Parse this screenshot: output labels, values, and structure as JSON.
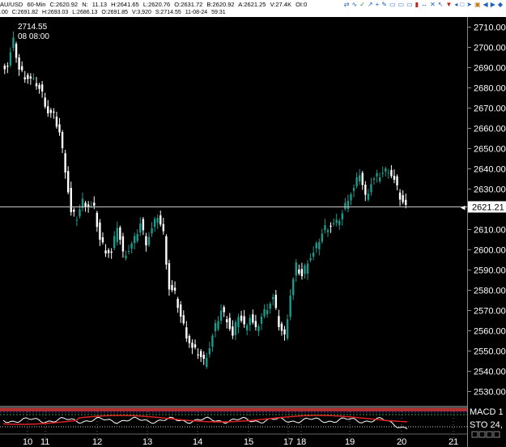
{
  "header": {
    "fields": [
      "AU/USD",
      "60-Min",
      "C:2620.92",
      "N:",
      "11.13",
      "H:2641.65",
      "L:2620.76",
      "O:2631.72",
      "B:2620.92",
      "A:2621.25",
      "V:27.4K",
      "OI:0"
    ]
  },
  "info_bar": {
    "fields": [
      ".00",
      "C:2691.82",
      "H:2693.03",
      "L:2686.13",
      "O:2691.85",
      "V:3,920",
      "S:2714.55",
      "11-08-24",
      "59:31"
    ]
  },
  "toolbar": {
    "icons": [
      "arrows-icon",
      "wave-icon",
      "check-icon",
      "trend-icon",
      "plus-icon",
      "pencil-icon",
      "box-icon",
      "box-icon-2",
      "box-icon-3",
      "bottle-icon",
      "arrows-icon-2",
      "cross-icon",
      "cursor-icon",
      "down-arrow-icon",
      "left-arrow-icon",
      "square-icon",
      "pointer-icon",
      "lock-icon",
      "prev-icon",
      "next-icon",
      "adjust-icon"
    ]
  },
  "hover": {
    "price": "2714.55",
    "time": "08 08:00"
  },
  "price_label": "2621.21",
  "indicators": {
    "macd": "MACD 1",
    "sto": "STO 24,"
  },
  "colors": {
    "up": "#1a9a8a",
    "down": "#ffffff",
    "background": "#000000",
    "sto": "#ffffff",
    "signal": "#dd2222"
  },
  "chart_data": {
    "type": "candlestick",
    "symbol": "AU/USD",
    "interval": "60-Min",
    "ylim": [
      2525,
      2715
    ],
    "yticks": [
      "2530.00",
      "2540.00",
      "2550.00",
      "2560.00",
      "2570.00",
      "2580.00",
      "2590.00",
      "2600.00",
      "2610.00",
      "2620.00",
      "2630.00",
      "2640.00",
      "2650.00",
      "2660.00",
      "2670.00",
      "2680.00",
      "2690.00",
      "2700.00",
      "2710.00"
    ],
    "xticks": [
      "10",
      "11",
      "12",
      "13",
      "14",
      "15",
      "17",
      "18",
      "19",
      "20",
      "21"
    ],
    "last_price": 2621.21,
    "close_path": [
      2691,
      2703,
      2689,
      2686,
      2684,
      2682,
      2677,
      2668,
      2666,
      2658,
      2640,
      2618,
      2616,
      2624,
      2622,
      2620,
      2605,
      2600,
      2598,
      2612,
      2598,
      2600,
      2605,
      2613,
      2604,
      2610,
      2617,
      2608,
      2581,
      2578,
      2567,
      2558,
      2551,
      2549,
      2545,
      2552,
      2562,
      2570,
      2566,
      2557,
      2568,
      2562,
      2567,
      2560,
      2567,
      2572,
      2576,
      2563,
      2557,
      2578,
      2592,
      2587,
      2595,
      2598,
      2605,
      2611,
      2612,
      2613,
      2618,
      2626,
      2630,
      2638,
      2626,
      2633,
      2636,
      2638,
      2640,
      2634,
      2626,
      2621
    ]
  }
}
